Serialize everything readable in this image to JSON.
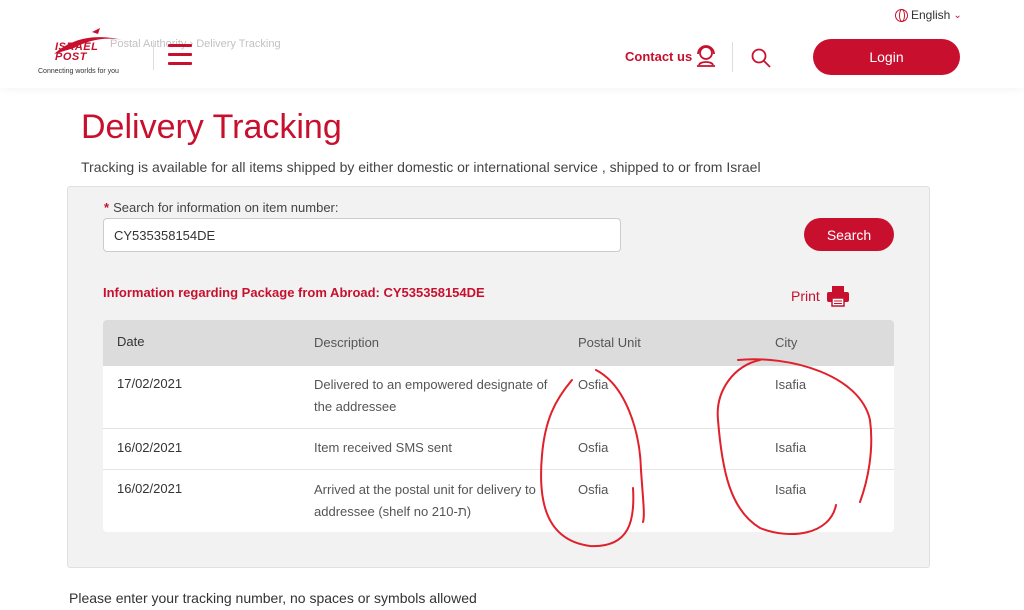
{
  "header": {
    "language": "English",
    "logo": {
      "name": "ISRAEL POST",
      "tagline": "Connecting worlds for you"
    },
    "breadcrumb": "Postal Authority › Delivery Tracking",
    "contact_label": "Contact us",
    "login_label": "Login"
  },
  "page": {
    "title": "Delivery Tracking",
    "subtitle": "Tracking is available for all items shipped by either domestic or international service , shipped to or from Israel"
  },
  "search": {
    "required_mark": "*",
    "label": "Search for information on item number:",
    "value": "CY535358154DE",
    "button_label": "Search"
  },
  "result": {
    "heading": "Information regarding Package from Abroad: CY535358154DE",
    "print_label": "Print",
    "columns": [
      "Date",
      "Description",
      "Postal Unit",
      "City"
    ],
    "rows": [
      {
        "date": "17/02/2021",
        "description": "Delivered to an empowered designate of the addressee",
        "postal_unit": "Osfia",
        "city": "Isafia"
      },
      {
        "date": "16/02/2021",
        "description": "Item received SMS sent",
        "postal_unit": "Osfia",
        "city": "Isafia"
      },
      {
        "date": "16/02/2021",
        "description": "Arrived at the postal unit for delivery to addressee (shelf no 210-ת)",
        "postal_unit": "Osfia",
        "city": "Isafia"
      }
    ]
  },
  "footer_note": "Please enter your tracking number, no spaces or symbols allowed",
  "colors": {
    "brand_red": "#c8102e",
    "annotation_red": "#e0202a"
  }
}
